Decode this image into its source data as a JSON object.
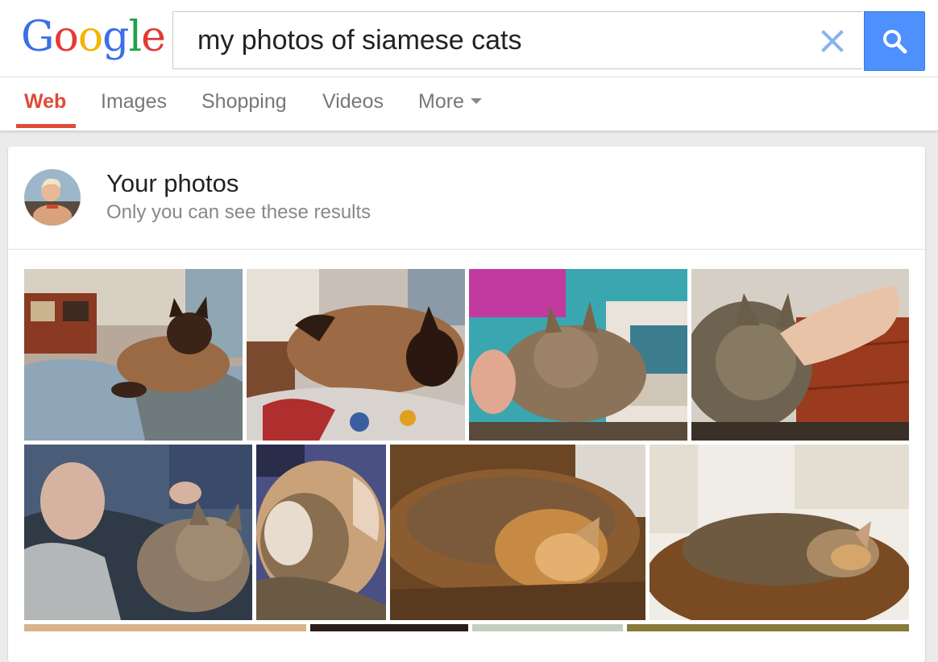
{
  "logo": {
    "letters": [
      "G",
      "o",
      "o",
      "g",
      "l",
      "e"
    ],
    "colors": [
      "#3c6fe6",
      "#e53935",
      "#f4b400",
      "#3c6fe6",
      "#21a24a",
      "#e53935"
    ]
  },
  "search": {
    "query": "my photos of siamese cats",
    "clear_icon": "close-icon",
    "submit_icon": "search-icon"
  },
  "tabs": {
    "items": [
      {
        "label": "Web",
        "active": true
      },
      {
        "label": "Images",
        "active": false
      },
      {
        "label": "Shopping",
        "active": false
      },
      {
        "label": "Videos",
        "active": false
      },
      {
        "label": "More",
        "active": false
      }
    ]
  },
  "photos_card": {
    "title": "Your photos",
    "subtitle": "Only you can see these results",
    "avatar_icon": "user-avatar",
    "images": [
      {
        "subject": "siamese-cat-on-couch"
      },
      {
        "subject": "siamese-cat-lying-on-blanket"
      },
      {
        "subject": "tabby-cat-being-petted"
      },
      {
        "subject": "tabby-cat-sleeping-on-hand"
      },
      {
        "subject": "woman-with-tabby-cat"
      },
      {
        "subject": "cat-curled-on-cushion"
      },
      {
        "subject": "tabby-cat-sleeping-on-bed"
      },
      {
        "subject": "tabby-cat-curled-on-bed"
      }
    ]
  },
  "colors": {
    "accent_red": "#dd4b39",
    "search_blue": "#4d90fe",
    "tab_gray": "#777777",
    "subtitle_gray": "#888888"
  }
}
